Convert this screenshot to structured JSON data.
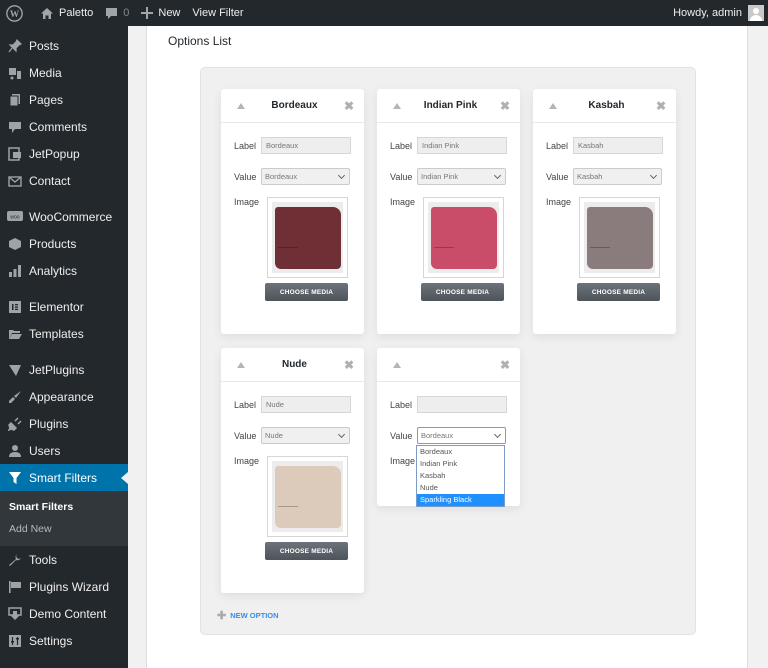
{
  "adminbar": {
    "site_name": "Paletto",
    "comments_count": "0",
    "new_label": "New",
    "view_filter_label": "View Filter",
    "greeting": "Howdy, admin"
  },
  "sidebar": {
    "items": [
      {
        "label": "Posts",
        "icon": "pin-icon"
      },
      {
        "label": "Media",
        "icon": "media-icon"
      },
      {
        "label": "Pages",
        "icon": "pages-icon"
      },
      {
        "label": "Comments",
        "icon": "comment-icon"
      },
      {
        "label": "JetPopup",
        "icon": "popup-icon"
      },
      {
        "label": "Contact",
        "icon": "envelope-icon"
      },
      {
        "label": "WooCommerce",
        "icon": "woo-icon"
      },
      {
        "label": "Products",
        "icon": "box-icon"
      },
      {
        "label": "Analytics",
        "icon": "bar-chart-icon"
      },
      {
        "label": "Elementor",
        "icon": "elementor-icon"
      },
      {
        "label": "Templates",
        "icon": "folder-icon"
      },
      {
        "label": "JetPlugins",
        "icon": "jet-icon"
      },
      {
        "label": "Appearance",
        "icon": "brush-icon"
      },
      {
        "label": "Plugins",
        "icon": "plug-icon"
      },
      {
        "label": "Users",
        "icon": "user-icon"
      },
      {
        "label": "Smart Filters",
        "icon": "filter-icon"
      },
      {
        "label": "Tools",
        "icon": "wrench-icon"
      },
      {
        "label": "Plugins Wizard",
        "icon": "flag-icon"
      },
      {
        "label": "Demo Content",
        "icon": "download-icon"
      },
      {
        "label": "Settings",
        "icon": "sliders-icon"
      }
    ],
    "submenu": [
      "Smart Filters",
      "Add New"
    ]
  },
  "main": {
    "section_title": "Options List",
    "labels": {
      "label": "Label",
      "value": "Value",
      "image": "Image",
      "choose_media": "CHOOSE MEDIA"
    },
    "options": [
      {
        "title": "Bordeaux",
        "label_value": "Bordeaux",
        "value_selected": "Bordeaux",
        "swatch_color": "#6e3034"
      },
      {
        "title": "Indian Pink",
        "label_value": "Indian Pink",
        "value_selected": "Indian Pink",
        "swatch_color": "#c94c68"
      },
      {
        "title": "Kasbah",
        "label_value": "Kasbah",
        "value_selected": "Kasbah",
        "swatch_color": "#8a7b7d"
      },
      {
        "title": "Nude",
        "label_value": "Nude",
        "value_selected": "Nude",
        "swatch_color": "#dccbbb"
      },
      {
        "title": "",
        "label_value": "",
        "value_selected": "Bordeaux",
        "dropdown_open": true
      }
    ],
    "dropdown_options": [
      "Bordeaux",
      "Indian Pink",
      "Kasbah",
      "Nude",
      "Sparkling Black"
    ],
    "dropdown_highlighted": "Sparkling Black",
    "new_option_label": "NEW OPTION"
  }
}
